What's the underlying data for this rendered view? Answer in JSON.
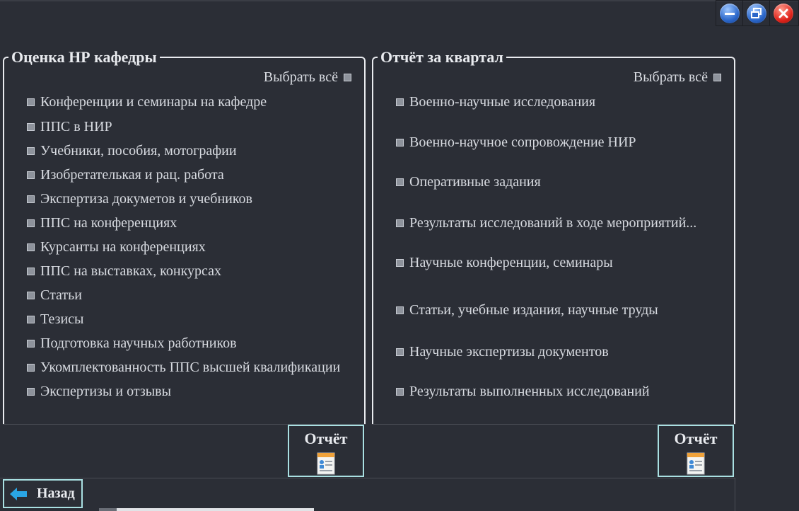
{
  "colors": {
    "background": "#2b2e36",
    "text": "#e9ebef",
    "accent_border": "#a9e0e2",
    "arrow": "#2aa6e6"
  },
  "left_panel": {
    "title": "Оценка НР кафедры",
    "select_all": "Выбрать всё",
    "items": [
      "Конференции и семинары на кафедре",
      "ППС в НИР",
      "Учебники, пособия, мотографии",
      "Изобретателькая и рац. работа",
      "Экспертиза докуметов и учебников",
      "ППС на конференциях",
      "Курсанты на конференциях",
      "ППС на выставках, конкурсах",
      "Статьи",
      "Тезисы",
      "Подготовка научных работников",
      "Укомплектованность ППС высшей квалификации",
      "Экспертизы и отзывы"
    ],
    "report_label": "Отчёт"
  },
  "right_panel": {
    "title": "Отчёт за квартал",
    "select_all": "Выбрать всё",
    "items": [
      "Военно-научные исследования",
      "Военно-научное сопровождение НИР",
      "Оперативные  задания",
      "Результаты исследований в ходе мероприятий...",
      "Научные конференции, семинары",
      "Статьи, учебные издания, научные труды",
      "Научные экспертизы документов",
      "Результаты выполненных исследований"
    ],
    "report_label": "Отчёт"
  },
  "footer": {
    "back_label": "Назад"
  },
  "icons": {
    "minimize": "minimize-icon",
    "restore": "restore-icon",
    "close": "close-icon",
    "back": "arrow-left-icon",
    "report": "document-icon"
  }
}
